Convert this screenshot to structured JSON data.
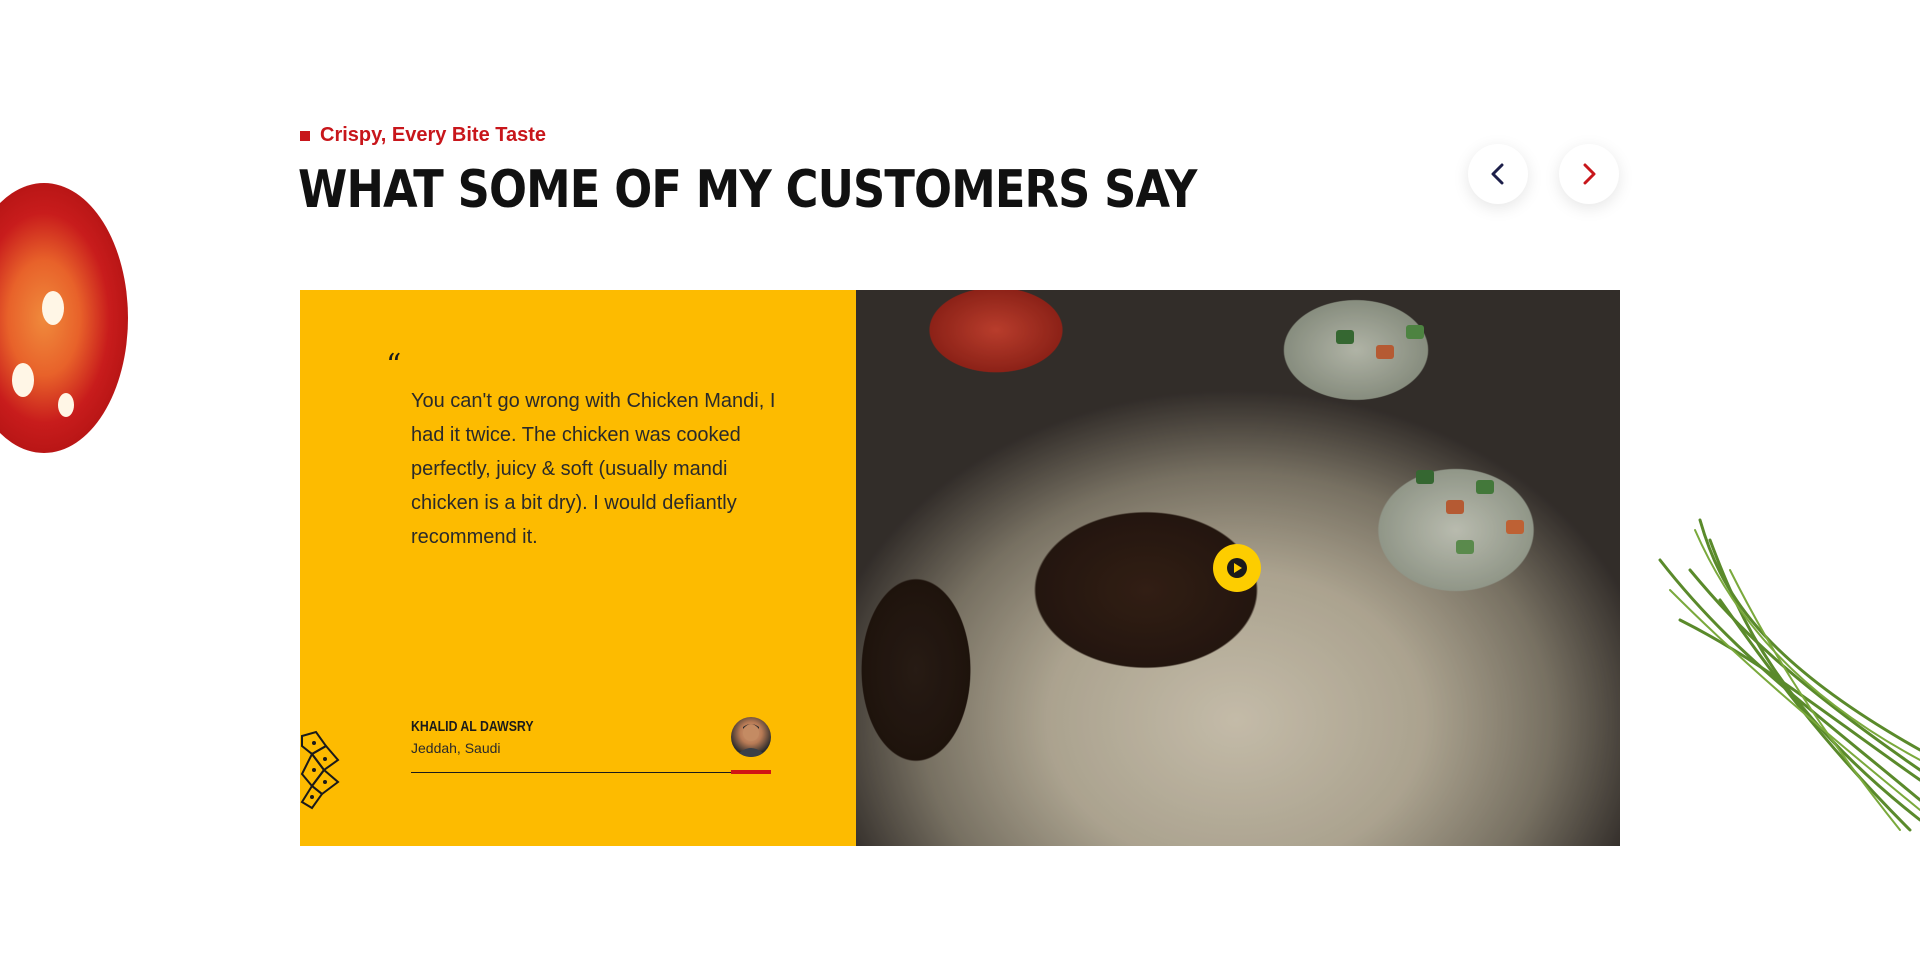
{
  "section": {
    "eyebrow": "Crispy, Every Bite Taste",
    "title": "WHAT SOME OF MY CUSTOMERS SAY"
  },
  "navigation": {
    "prev_icon": "chevron-left-icon",
    "next_icon": "chevron-right-icon"
  },
  "testimonial": {
    "quote_mark": "“",
    "quote": "You can't go wrong with Chicken Mandi, I had it twice. The chicken was cooked perfectly, juicy & soft (usually mandi chicken is a bit dry). I would defiantly recommend it.",
    "author_name": "KHALID AL DAWSRY",
    "author_location": "Jeddah, Saudi",
    "play_icon": "play-icon"
  },
  "colors": {
    "accent_red": "#c8161b",
    "panel_yellow": "#fdbb00",
    "play_yellow": "#fdcd00",
    "title_dark": "#111111"
  }
}
